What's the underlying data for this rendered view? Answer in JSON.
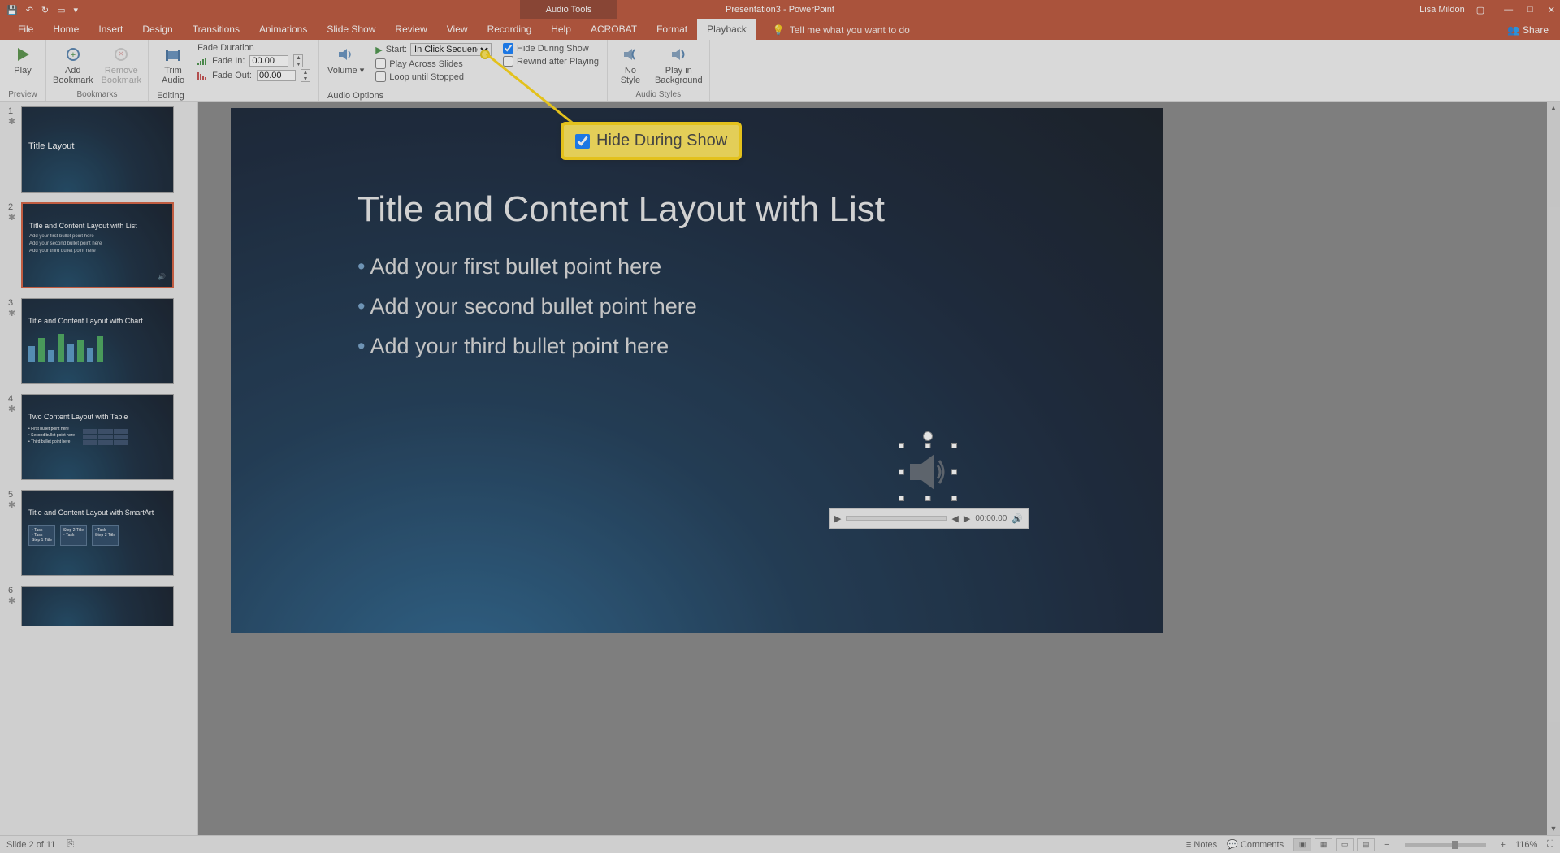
{
  "titlebar": {
    "title": "Presentation3 - PowerPoint",
    "contextual_tab": "Audio Tools",
    "user": "Lisa Mildon"
  },
  "tabs": [
    "File",
    "Home",
    "Insert",
    "Design",
    "Transitions",
    "Animations",
    "Slide Show",
    "Review",
    "View",
    "Recording",
    "Help",
    "ACROBAT",
    "Format",
    "Playback"
  ],
  "active_tab_index": 13,
  "tellme": "Tell me what you want to do",
  "share": "Share",
  "ribbon": {
    "preview_group": "Preview",
    "play": "Play",
    "bookmarks_group": "Bookmarks",
    "add_bookmark": "Add\nBookmark",
    "remove_bookmark": "Remove\nBookmark",
    "editing_group": "Editing",
    "trim_audio": "Trim\nAudio",
    "fade_title": "Fade Duration",
    "fade_in": "Fade In:",
    "fade_out": "Fade Out:",
    "fade_in_val": "00.00",
    "fade_out_val": "00.00",
    "audio_options_group": "Audio Options",
    "volume": "Volume",
    "start_label": "Start:",
    "start_value": "In Click Sequence",
    "play_across": "Play Across Slides",
    "loop": "Loop until Stopped",
    "hide_during": "Hide During Show",
    "rewind": "Rewind after Playing",
    "audio_styles_group": "Audio Styles",
    "no_style": "No\nStyle",
    "play_bg": "Play in\nBackground"
  },
  "thumbs": [
    {
      "num": "1",
      "title": "Title Layout",
      "sub": ""
    },
    {
      "num": "2",
      "title": "Title and Content Layout with List",
      "bullets": [
        "Add your first bullet point here",
        "Add your second bullet point here",
        "Add your third bullet point here"
      ]
    },
    {
      "num": "3",
      "title": "Title and Content Layout with Chart"
    },
    {
      "num": "4",
      "title": "Two Content Layout with Table"
    },
    {
      "num": "5",
      "title": "Title and Content Layout with SmartArt"
    },
    {
      "num": "6",
      "title": ""
    }
  ],
  "slide": {
    "title": "Title and Content Layout with List",
    "bullets": [
      "Add your first bullet point here",
      "Add your second bullet point here",
      "Add your third bullet point here"
    ]
  },
  "player_time": "00:00.00",
  "callout_label": "Hide During Show",
  "status": {
    "slide": "Slide 2 of 11",
    "notes": "Notes",
    "comments": "Comments",
    "zoom": "116%"
  }
}
